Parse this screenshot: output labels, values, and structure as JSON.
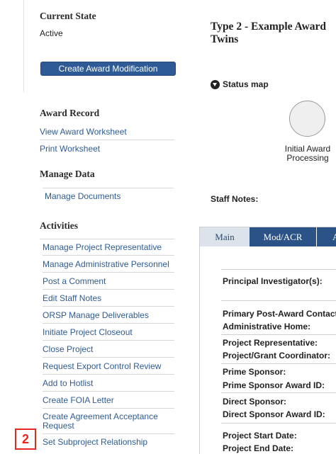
{
  "sidebar": {
    "current_state": {
      "title": "Current State",
      "value": "Active"
    },
    "create_mod_button": "Create Award Modification",
    "award_record": {
      "title": "Award Record",
      "links": [
        "View Award Worksheet",
        "Print Worksheet"
      ]
    },
    "manage_data": {
      "title": "Manage Data",
      "links": [
        "Manage Documents"
      ]
    },
    "activities": {
      "title": "Activities",
      "links": [
        "Manage Project Representative",
        "Manage Administrative Personnel",
        "Post a Comment",
        "Edit Staff Notes",
        "ORSP Manage Deliverables",
        "Initiate Project Closeout",
        "Close Project",
        "Request Export Control Review",
        "Add to Hotlist",
        "Create FOIA Letter",
        "Create Agreement Acceptance Request",
        "Set Subproject Relationship"
      ]
    }
  },
  "main": {
    "title": "Type 2 -  Example Award Twins",
    "status_map": {
      "label": "Status map",
      "icon": "collapse-toggle-icon",
      "node_label": "Initial Award Processing"
    },
    "staff_notes_label": "Staff Notes:",
    "tabs": [
      {
        "label": "Main",
        "active": true
      },
      {
        "label": "Mod/ACR",
        "active": false
      },
      {
        "label": "A",
        "active": false
      }
    ],
    "fields": [
      "Principal Investigator(s):",
      "Primary Post-Award Contact:",
      "Administrative Home:",
      "Project Representative:",
      "Project/Grant Coordinator:",
      "Prime Sponsor:",
      "Prime Sponsor Award ID:",
      "Direct Sponsor:",
      "Direct Sponsor Award ID:",
      "Project Start Date:",
      "Project End Date:"
    ]
  },
  "annotation": {
    "badge": "2",
    "color": "#e8261f"
  },
  "colors": {
    "link": "#2e5b95",
    "button": "#2e5b95",
    "tab_inactive": "#2b5387",
    "tab_active": "#dde3ea"
  }
}
